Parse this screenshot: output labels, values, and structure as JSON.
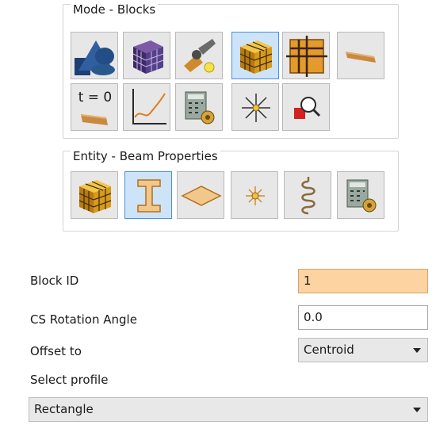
{
  "mode_panel": {
    "title": "Mode - Blocks",
    "buttons": [
      {
        "icon": "geometry-shapes-icon"
      },
      {
        "icon": "mesh-cube-icon"
      },
      {
        "icon": "tools-wrench-icon"
      },
      {
        "icon": "blocks-cube-icon",
        "active": true
      },
      {
        "icon": "grid-block-icon"
      },
      {
        "icon": "beam-plank-icon"
      },
      {
        "icon": "initial-condition-icon",
        "text": "t = 0"
      },
      {
        "icon": "curve-plot-icon"
      },
      {
        "icon": "calculator-gear-icon"
      },
      {
        "icon": "loads-burst-icon"
      },
      {
        "icon": "inspect-magnify-icon"
      }
    ]
  },
  "entity_panel": {
    "title": "Entity - Beam Properties",
    "buttons": [
      {
        "icon": "block-cube-icon"
      },
      {
        "icon": "i-beam-icon",
        "active": true
      },
      {
        "icon": "shell-plate-icon"
      },
      {
        "icon": "point-star-icon"
      },
      {
        "icon": "spring-coil-icon"
      },
      {
        "icon": "calculator-gear-icon"
      }
    ]
  },
  "form": {
    "block_id": {
      "label": "Block ID",
      "value": "1"
    },
    "cs_rotation": {
      "label": "CS Rotation Angle",
      "value": "0.0"
    },
    "offset": {
      "label": "Offset to",
      "value": "Centroid"
    },
    "profile": {
      "label": "Select profile",
      "value": "Rectangle"
    }
  },
  "colors": {
    "active_button": "#cde3f7",
    "highlight_field": "#fcd3a1",
    "button_face": "#e7e7e7"
  }
}
